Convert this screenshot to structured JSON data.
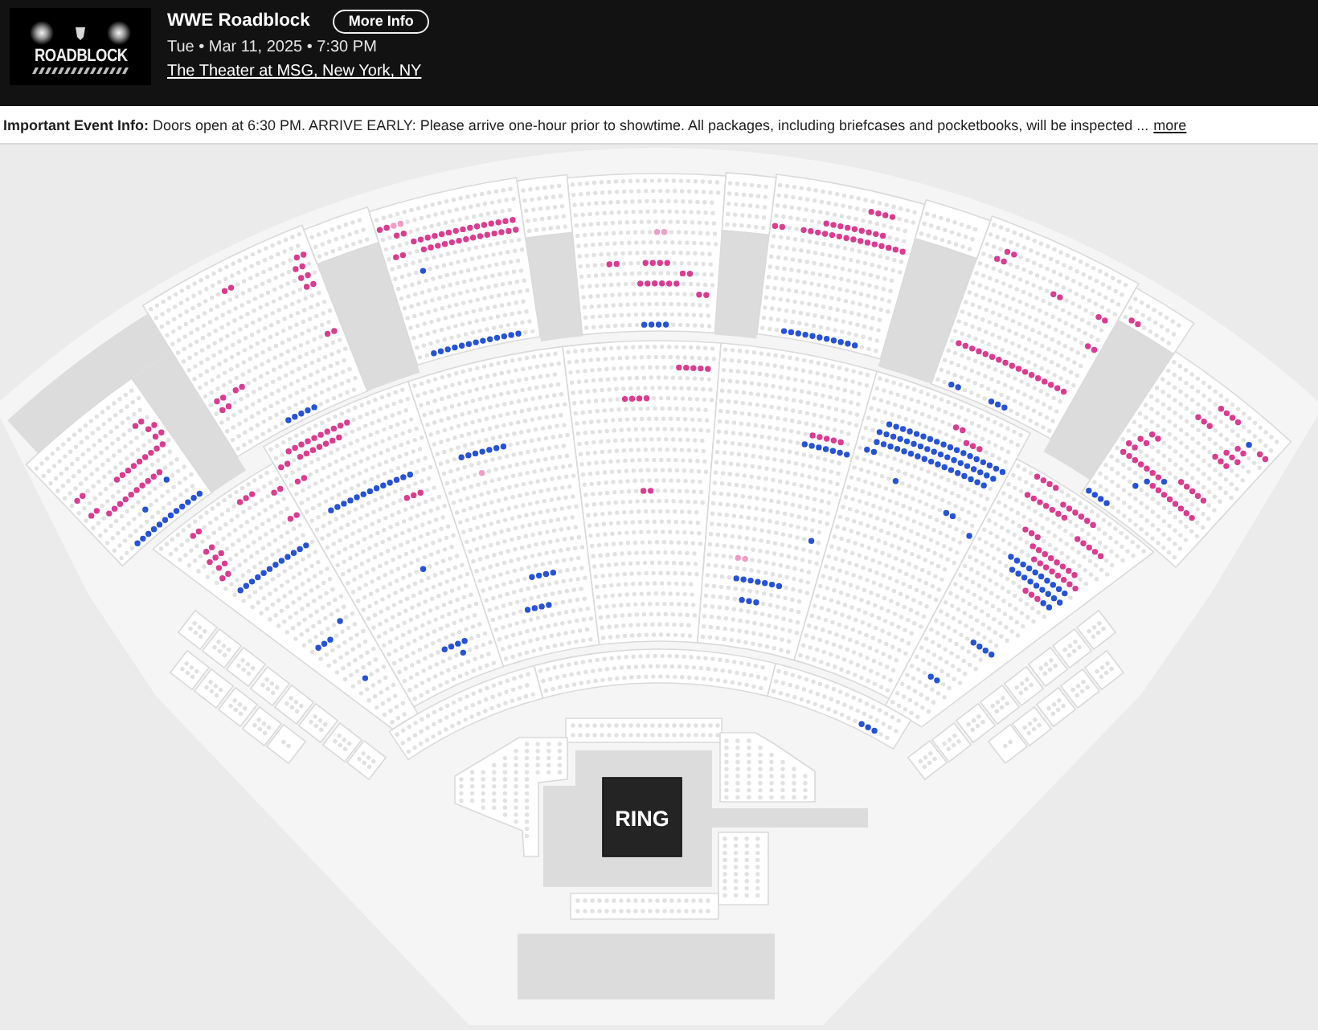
{
  "event": {
    "logo_text": "ROADBLOCK",
    "title": "WWE Roadblock",
    "more_info_button": "More Info",
    "date_time": "Tue • Mar 11, 2025 • 7:30 PM",
    "venue_link": "The Theater at MSG, New York, NY"
  },
  "event_info": {
    "text": "**Important Event Info:** Doors open at 6:30 PM. ARRIVE EARLY: Please arrive one-hour prior to showtime. All packages, including briefcases and pocketbooks, will be inspected ...",
    "more_link": "more"
  },
  "seat_map": {
    "stage_label": "RING",
    "sections": [
      {
        "seat_groups": [
          {
            "color": "#2552d8"
          },
          {
            "color": "#2552d8"
          },
          {
            "color": "#2552d8"
          },
          {
            "color": "#dc3b8f"
          },
          {
            "color": "#dc3b8f"
          },
          {
            "color": "#dc3b8f"
          },
          {
            "color": "#dc3b8f"
          },
          {
            "color": "#dc3b8f"
          },
          {
            "color": "#dc3b8f"
          },
          {
            "color": "#dc3b8f"
          }
        ]
      },
      {
        "seat_groups": [
          {
            "color": "#dc3b8f"
          },
          {
            "color": "#dc3b8f"
          },
          {
            "color": "#dc3b8f"
          },
          {
            "color": "#dc3b8f"
          },
          {
            "color": "#dc3b8f"
          },
          {
            "color": "#dc3b8f"
          },
          {
            "color": "#dc3b8f"
          },
          {
            "color": "#dc3b8f"
          },
          {
            "color": "#dc3b8f"
          },
          {
            "color": "#2552d8"
          }
        ]
      },
      {
        "seat_groups": [
          {
            "color": "#dc3b8f"
          },
          {
            "color": "#f09cc6"
          },
          {
            "color": "#dc3b8f"
          },
          {
            "color": "#dc3b8f"
          },
          {
            "color": "#dc3b8f"
          },
          {
            "color": "#dc3b8f"
          },
          {
            "color": "#2552d8"
          },
          {
            "color": "#2552d8"
          }
        ]
      },
      {
        "seat_groups": [
          {
            "color": "#f09cc6"
          },
          {
            "color": "#dc3b8f"
          },
          {
            "color": "#dc3b8f"
          },
          {
            "color": "#dc3b8f"
          },
          {
            "color": "#dc3b8f"
          },
          {
            "color": "#dc3b8f"
          },
          {
            "color": "#2552d8"
          }
        ]
      },
      {
        "seat_groups": [
          {
            "color": "#dc3b8f"
          },
          {
            "color": "#dc3b8f"
          },
          {
            "color": "#dc3b8f"
          },
          {
            "color": "#dc3b8f"
          },
          {
            "color": "#2552d8"
          }
        ]
      },
      {
        "seat_groups": [
          {
            "color": "#dc3b8f"
          },
          {
            "color": "#dc3b8f"
          },
          {
            "color": "#dc3b8f"
          },
          {
            "color": "#dc3b8f"
          },
          {
            "color": "#dc3b8f"
          },
          {
            "color": "#dc3b8f"
          },
          {
            "color": "#2552d8"
          },
          {
            "color": "#2552d8"
          }
        ]
      },
      {
        "seat_groups": [
          {
            "color": "#dc3b8f"
          }
        ]
      },
      {
        "seat_groups": [
          {
            "color": "#2552d8"
          },
          {
            "color": "#dc3b8f"
          },
          {
            "color": "#dc3b8f"
          },
          {
            "color": "#dc3b8f"
          },
          {
            "color": "#dc3b8f"
          },
          {
            "color": "#2552d8"
          },
          {
            "color": "#2552d8"
          },
          {
            "color": "#2552d8"
          },
          {
            "color": "#dc3b8f"
          },
          {
            "color": "#dc3b8f"
          },
          {
            "color": "#dc3b8f"
          },
          {
            "color": "#dc3b8f"
          },
          {
            "color": "#2552d8"
          },
          {
            "color": "#dc3b8f"
          },
          {
            "color": "#dc3b8f"
          },
          {
            "color": "#dc3b8f"
          },
          {
            "color": "#dc3b8f"
          }
        ]
      },
      {
        "seat_groups": [
          {
            "color": "#dc3b8f"
          },
          {
            "color": "#dc3b8f"
          },
          {
            "color": "#dc3b8f"
          },
          {
            "color": "#dc3b8f"
          },
          {
            "color": "#dc3b8f"
          },
          {
            "color": "#dc3b8f"
          },
          {
            "color": "#dc3b8f"
          },
          {
            "color": "#dc3b8f"
          },
          {
            "color": "#2552d8"
          },
          {
            "color": "#2552d8"
          },
          {
            "color": "#2552d8"
          },
          {
            "color": "#2552d8"
          }
        ]
      },
      {
        "seat_groups": [
          {
            "color": "#dc3b8f"
          },
          {
            "color": "#dc3b8f"
          },
          {
            "color": "#dc3b8f"
          },
          {
            "color": "#dc3b8f"
          },
          {
            "color": "#2552d8"
          },
          {
            "color": "#dc3b8f"
          },
          {
            "color": "#2552d8"
          },
          {
            "color": "#2552d8"
          },
          {
            "color": "#2552d8"
          }
        ]
      },
      {
        "seat_groups": [
          {
            "color": "#2552d8"
          },
          {
            "color": "#f09cc6"
          },
          {
            "color": "#2552d8"
          },
          {
            "color": "#2552d8"
          }
        ]
      },
      {
        "seat_groups": [
          {
            "color": "#dc3b8f"
          },
          {
            "color": "#dc3b8f"
          },
          {
            "color": "#dc3b8f"
          }
        ]
      },
      {
        "seat_groups": [
          {
            "color": "#dc3b8f"
          },
          {
            "color": "#2552d8"
          },
          {
            "color": "#2552d8"
          },
          {
            "color": "#f09cc6"
          },
          {
            "color": "#2552d8"
          },
          {
            "color": "#2552d8"
          }
        ]
      },
      {
        "seat_groups": [
          {
            "color": "#dc3b8f"
          },
          {
            "color": "#dc3b8f"
          },
          {
            "color": "#2552d8"
          },
          {
            "color": "#2552d8"
          },
          {
            "color": "#2552d8"
          },
          {
            "color": "#2552d8"
          },
          {
            "color": "#2552d8"
          },
          {
            "color": "#2552d8"
          },
          {
            "color": "#2552d8"
          }
        ]
      },
      {
        "seat_groups": [
          {
            "color": "#dc3b8f"
          },
          {
            "color": "#dc3b8f"
          },
          {
            "color": "#dc3b8f"
          },
          {
            "color": "#dc3b8f"
          },
          {
            "color": "#dc3b8f"
          },
          {
            "color": "#dc3b8f"
          },
          {
            "color": "#dc3b8f"
          },
          {
            "color": "#2552d8"
          },
          {
            "color": "#2552d8"
          },
          {
            "color": "#dc3b8f"
          },
          {
            "color": "#2552d8"
          },
          {
            "color": "#2552d8"
          },
          {
            "color": "#2552d8"
          }
        ]
      },
      {
        "seat_groups": [
          {
            "color": "#2552d8"
          }
        ]
      }
    ]
  }
}
